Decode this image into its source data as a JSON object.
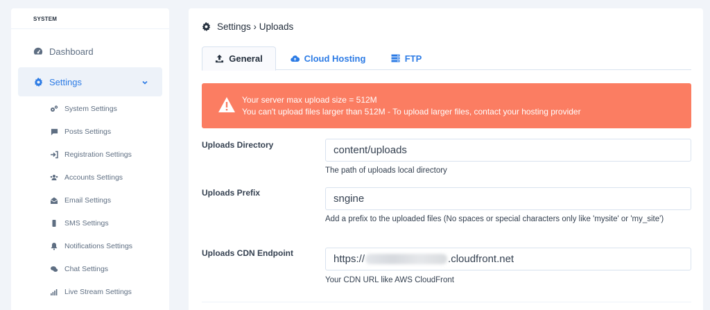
{
  "sidebar": {
    "section_label": "SYSTEM",
    "items": [
      {
        "label": "Dashboard",
        "icon": "dashboard-icon"
      },
      {
        "label": "Settings",
        "icon": "gear-icon",
        "active": true
      }
    ],
    "sub_items": [
      {
        "label": "System Settings",
        "icon": "gears-icon"
      },
      {
        "label": "Posts Settings",
        "icon": "comment-icon"
      },
      {
        "label": "Registration Settings",
        "icon": "sign-in-icon"
      },
      {
        "label": "Accounts Settings",
        "icon": "users-icon"
      },
      {
        "label": "Email Settings",
        "icon": "envelope-open-icon"
      },
      {
        "label": "SMS Settings",
        "icon": "mobile-icon"
      },
      {
        "label": "Notifications Settings",
        "icon": "bell-icon"
      },
      {
        "label": "Chat Settings",
        "icon": "comments-icon"
      },
      {
        "label": "Live Stream Settings",
        "icon": "signal-icon"
      }
    ]
  },
  "main": {
    "breadcrumb": "Settings › Uploads",
    "tabs": [
      {
        "label": "General",
        "active": true
      },
      {
        "label": "Cloud Hosting"
      },
      {
        "label": "FTP"
      }
    ],
    "alert": {
      "line1": "Your server max upload size = 512M",
      "line2": "You can't upload files larger than 512M - To upload larger files, contact your hosting provider"
    },
    "fields": {
      "directory": {
        "label": "Uploads Directory",
        "value": "content/uploads",
        "help": "The path of uploads local directory"
      },
      "prefix": {
        "label": "Uploads Prefix",
        "value": "sngine",
        "help": "Add a prefix to the uploaded files (No spaces or special characters only like 'mysite' or 'my_site')"
      },
      "cdn": {
        "label": "Uploads CDN Endpoint",
        "value_prefix": "https://",
        "value_suffix": ".cloudfront.net",
        "help": "Your CDN URL like AWS CloudFront"
      }
    }
  },
  "colors": {
    "accent": "#2c7be5",
    "alert": "#fb7d62",
    "background": "#f1f4f9"
  }
}
